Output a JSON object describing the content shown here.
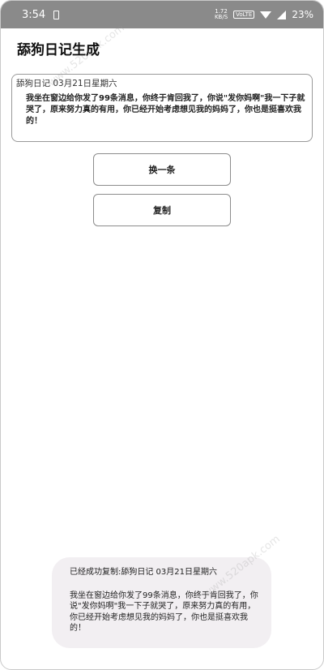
{
  "status_bar": {
    "time": "3:54",
    "speed_top": "1.72",
    "speed_unit": "KB/S",
    "volte": "VoLTE",
    "battery": "23%"
  },
  "app": {
    "title": "舔狗日记生成"
  },
  "diary": {
    "date": "舔狗日记 03月21日星期六",
    "text": "我坐在窗边给你发了99条消息，你终于肯回我了，你说\"发你妈啊\"我一下子就哭了，原来努力真的有用，你已经开始考虑想见我的妈妈了，你也是挺喜欢我的！"
  },
  "buttons": {
    "next_label": "换一条",
    "copy_label": "复制"
  },
  "toast": {
    "title": "已经成功复制:舔狗日记 03月21日星期六",
    "body": "我坐在窗边给你发了99条消息，你终于肯回我了，你说\"发你妈啊\"我一下子就哭了，原来努力真的有用，你已经开始考虑想见我的妈妈了，你也是挺喜欢我的！"
  },
  "watermark": "www.520apk.com"
}
